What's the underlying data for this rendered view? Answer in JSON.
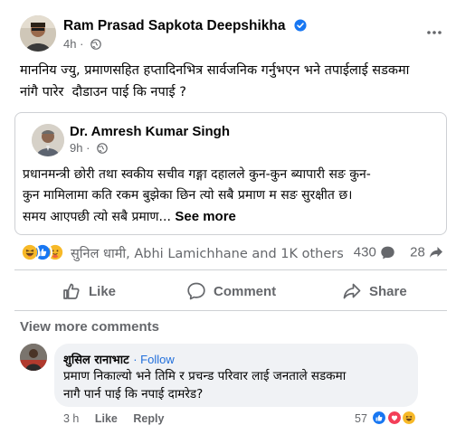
{
  "post": {
    "author": "Ram Prasad Sapkota Deepshikha",
    "time": "4h",
    "text_line1": "माननिय ज्यु, प्रमाणसहित हप्तादिनभित्र सार्वजनिक गर्नुभएन भने तपाईलाई सडकमा",
    "text_line2": "नांगै पारेर  दौडाउन पाई कि नपाई ?"
  },
  "shared": {
    "author": "Dr. Amresh Kumar Singh",
    "time": "9h",
    "text_line1": "प्रधानमन्त्री छोरी तथा स्वकीय सचीव गङ्गा दहालले कुन-कुन ब्यापारी सङ कुन-",
    "text_line2": "कुन मामिलामा कति रकम बुझेका छिन त्यो सबै प्रमाण म सङ सुरक्षीत छ।",
    "text_line3": "समय आएपछी त्यो सबै प्रमाण...",
    "see_more": "See more"
  },
  "reactions": {
    "names": "सुनिल धामी, Abhi Lamichhane and 1K others",
    "comments": "430",
    "shares": "28",
    "icons": [
      "haha",
      "like",
      "care"
    ]
  },
  "actions": {
    "like": "Like",
    "comment": "Comment",
    "share": "Share"
  },
  "view_more": "View more comments",
  "comment": {
    "author": "शुसिल रानाभाट",
    "follow": "· Follow",
    "text_line1": "प्रमाण निकाल्यो भने तिमि र प्रचन्ड परिवार लाई जनताले सडकमा",
    "text_line2": "नागै पार्न पाई कि नपाई दामरेड?",
    "time": "3 h",
    "like": "Like",
    "reply": "Reply",
    "react_count": "57"
  },
  "colors": {
    "brand_blue": "#1877f2",
    "secondary_text": "#65676b",
    "divider": "#ced0d4",
    "comment_bg": "#f0f2f5"
  }
}
